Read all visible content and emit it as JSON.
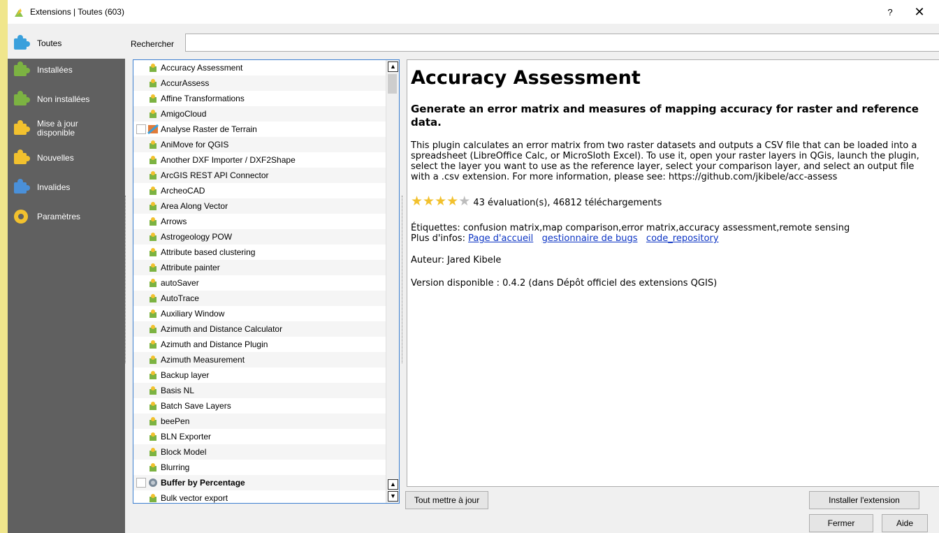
{
  "window": {
    "title": "Extensions | Toutes (603)",
    "help_label": "?",
    "close_label": "✕"
  },
  "sidebar": {
    "items": [
      {
        "label": "Toutes",
        "icon": "puzzle-all-icon"
      },
      {
        "label": "Installées",
        "icon": "puzzle-installed-icon"
      },
      {
        "label": "Non installées",
        "icon": "puzzle-not-installed-icon"
      },
      {
        "label": "Mise à jour\ndisponible",
        "icon": "puzzle-update-icon"
      },
      {
        "label": "Nouvelles",
        "icon": "puzzle-new-icon"
      },
      {
        "label": "Invalides",
        "icon": "puzzle-invalid-icon"
      },
      {
        "label": "Paramètres",
        "icon": "gear-icon"
      }
    ]
  },
  "search": {
    "label": "Rechercher",
    "value": ""
  },
  "plugins": [
    "Accuracy Assessment",
    "AccurAssess",
    "Affine Transformations",
    "AmigoCloud",
    "Analyse Raster de Terrain",
    "AniMove for QGIS",
    "Another DXF Importer / DXF2Shape",
    "ArcGIS REST API Connector",
    "ArcheoCAD",
    "Area Along Vector",
    "Arrows",
    "Astrogeology POW",
    "Attribute based clustering",
    "Attribute painter",
    "autoSaver",
    "AutoTrace",
    "Auxiliary Window",
    "Azimuth and Distance Calculator",
    "Azimuth and Distance Plugin",
    "Azimuth Measurement",
    "Backup layer",
    "Basis NL",
    "Batch Save Layers",
    "beePen",
    "BLN Exporter",
    "Block Model",
    "Blurring",
    "Buffer by Percentage",
    "Bulk vector export"
  ],
  "details": {
    "title": "Accuracy Assessment",
    "subtitle": "Generate an error matrix and measures of mapping accuracy for raster and reference data.",
    "description": "This plugin calculates an error matrix from two raster datasets and outputs a CSV file that can be loaded into a spreadsheet (LibreOffice Calc, or MicroSloth Excel). To use it, open your raster layers in QGis, launch the plugin, select the layer you want to use as the reference layer, select your comparison layer, and select an output file with a .csv extension. For more information, please see: https://github.com/jkibele/acc-assess",
    "rating_stars": 4,
    "rating_text": "43 évaluation(s), 46812 téléchargements",
    "tags": "Étiquettes: confusion matrix,map comparison,error matrix,accuracy assessment,remote sensing",
    "more_info_label": "Plus d'infos:",
    "link_homepage": "Page d'accueil",
    "link_bugs": "gestionnaire de bugs",
    "link_repo": "code_repository",
    "author": "Auteur: Jared Kibele",
    "version": "Version disponible : 0.4.2 (dans Dépôt officiel des extensions QGIS)"
  },
  "buttons": {
    "upgrade_all": "Tout mettre à jour",
    "install": "Installer l'extension",
    "close": "Fermer",
    "help": "Aide"
  }
}
